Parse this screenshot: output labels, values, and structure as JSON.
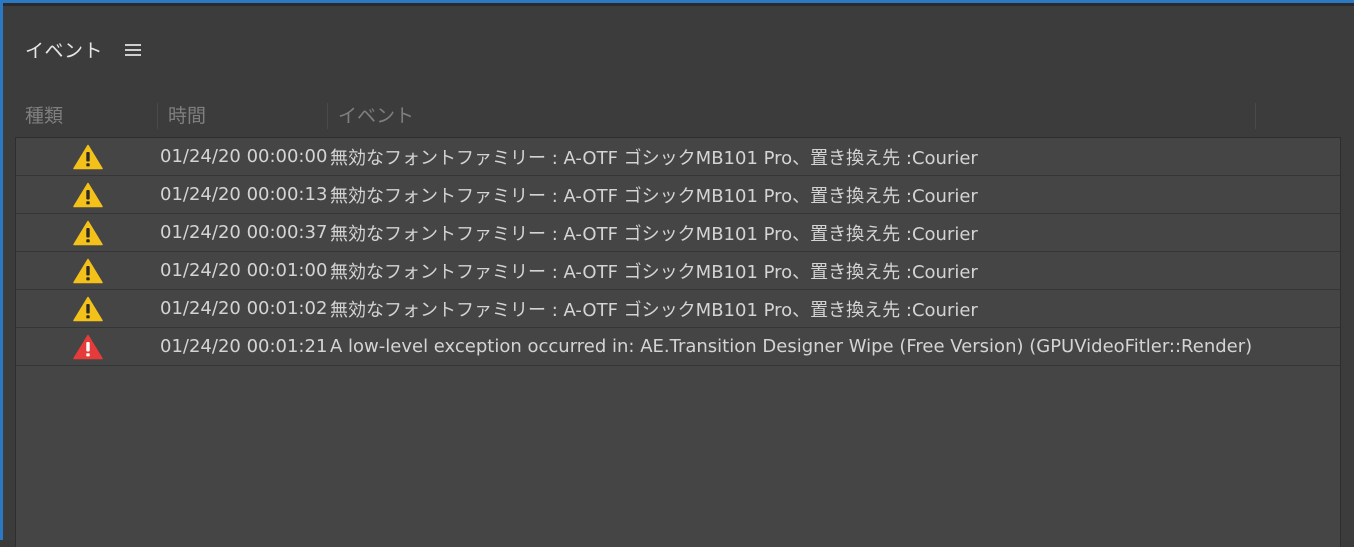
{
  "panel": {
    "title": "イベント",
    "menu_icon": "hamburger-menu-icon"
  },
  "columns": [
    {
      "label": "種類"
    },
    {
      "label": "時間"
    },
    {
      "label": "イベント"
    }
  ],
  "rows": [
    {
      "type": "warning",
      "icon": "warning-icon",
      "icon_color": "#f3c119",
      "time": "01/24/20 00:00:00",
      "message": "無効なフォントファミリー : A-OTF ゴシックMB101 Pro、置き換え先 :Courier"
    },
    {
      "type": "warning",
      "icon": "warning-icon",
      "icon_color": "#f3c119",
      "time": "01/24/20 00:00:13",
      "message": "無効なフォントファミリー : A-OTF ゴシックMB101 Pro、置き換え先 :Courier"
    },
    {
      "type": "warning",
      "icon": "warning-icon",
      "icon_color": "#f3c119",
      "time": "01/24/20 00:00:37",
      "message": "無効なフォントファミリー : A-OTF ゴシックMB101 Pro、置き換え先 :Courier"
    },
    {
      "type": "warning",
      "icon": "warning-icon",
      "icon_color": "#f3c119",
      "time": "01/24/20 00:01:00",
      "message": "無効なフォントファミリー : A-OTF ゴシックMB101 Pro、置き換え先 :Courier"
    },
    {
      "type": "warning",
      "icon": "warning-icon",
      "icon_color": "#f3c119",
      "time": "01/24/20 00:01:02",
      "message": "無効なフォントファミリー : A-OTF ゴシックMB101 Pro、置き換え先 :Courier"
    },
    {
      "type": "error",
      "icon": "error-icon",
      "icon_color": "#e53b3b",
      "time": "01/24/20 00:01:21",
      "message": "A low-level exception occurred in: AE.Transition Designer Wipe (Free Version) (GPUVideoFitler::Render)"
    }
  ],
  "colors": {
    "accent_border": "#2b78c5",
    "warning": "#f3c119",
    "error": "#e53b3b"
  }
}
